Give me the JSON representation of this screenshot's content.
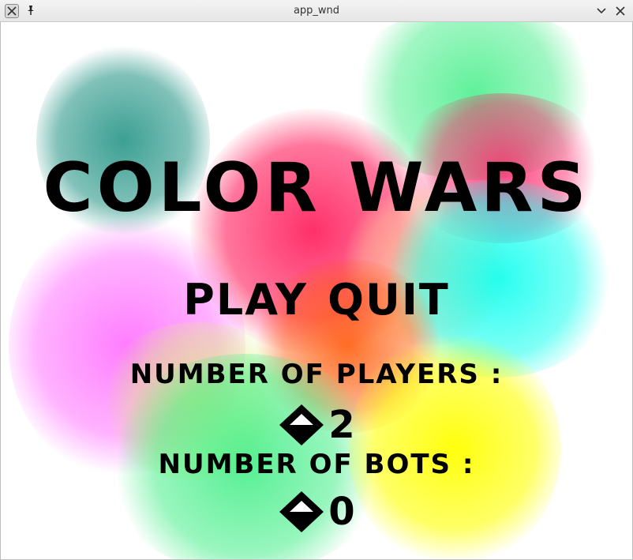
{
  "window": {
    "title": "app_wnd"
  },
  "icons": {
    "app": "app-icon",
    "pin": "pin-icon",
    "minimize": "chevron-down-icon",
    "close": "close-icon",
    "stepper": "up-down-arrows-icon"
  },
  "paint_colors": [
    "#1a8f80",
    "#ff1a5a",
    "#ff66ff",
    "#00ffee",
    "#44ee88",
    "#ffff00",
    "#ff5500",
    "#ffcc99"
  ],
  "game": {
    "title": "COLOR WARS",
    "menu": {
      "play": "PLAY",
      "quit": "QUIT"
    },
    "players_label": "NUMBER OF PLAYERS :",
    "players_value": "2",
    "bots_label": "NUMBER OF BOTS :",
    "bots_value": "0"
  }
}
